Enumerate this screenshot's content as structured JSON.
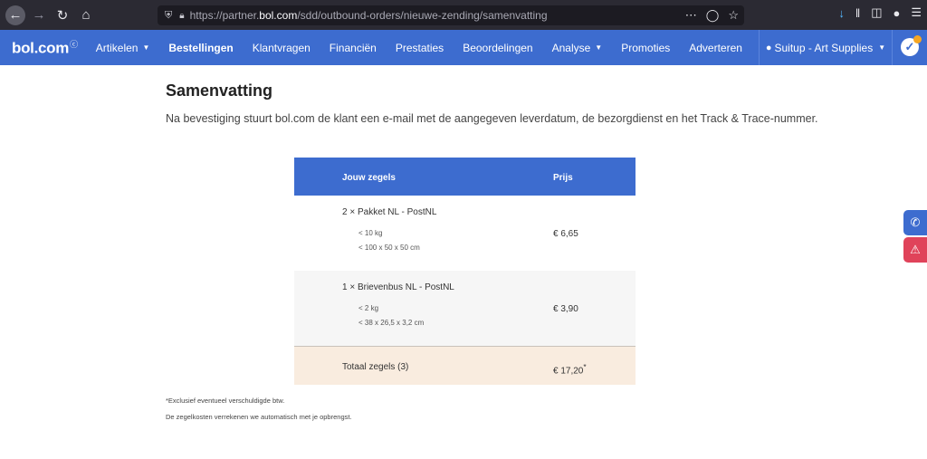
{
  "browser": {
    "url_prefix": "https://partner.",
    "url_host": "bol.com",
    "url_path": "/sdd/outbound-orders/nieuwe-zending/samenvatting"
  },
  "app": {
    "logo": "bol.com",
    "nav": [
      {
        "label": "Artikelen",
        "dropdown": true
      },
      {
        "label": "Bestellingen",
        "active": true
      },
      {
        "label": "Klantvragen"
      },
      {
        "label": "Financiën"
      },
      {
        "label": "Prestaties"
      },
      {
        "label": "Beoordelingen"
      },
      {
        "label": "Analyse",
        "dropdown": true
      },
      {
        "label": "Promoties"
      },
      {
        "label": "Adverteren"
      }
    ],
    "account": "Suitup - Art Supplies",
    "brand_color": "#3d6ccf"
  },
  "page": {
    "title": "Samenvatting",
    "intro": "Na bevestiging stuurt bol.com de klant een e-mail met de aangegeven leverdatum, de bezorgdienst en het Track & Trace-nummer."
  },
  "summary": {
    "head_item": "Jouw zegels",
    "head_price": "Prijs",
    "rows": [
      {
        "item": "2 × Pakket NL - PostNL",
        "spec1": "< 10 kg",
        "spec2": "< 100 x 50 x 50 cm",
        "price": "€ 6,65"
      },
      {
        "item": "1 × Brievenbus NL - PostNL",
        "spec1": "< 2 kg",
        "spec2": "< 38 x 26,5 x 3,2 cm",
        "price": "€ 3,90"
      }
    ],
    "total_label": "Totaal zegels (3)",
    "total_price": "€ 17,20",
    "total_mark": "*"
  },
  "notes": {
    "vat": "*Exclusief eventueel verschuldigde btw.",
    "settle": "De zegelkosten verrekenen we automatisch met je opbrengst."
  }
}
